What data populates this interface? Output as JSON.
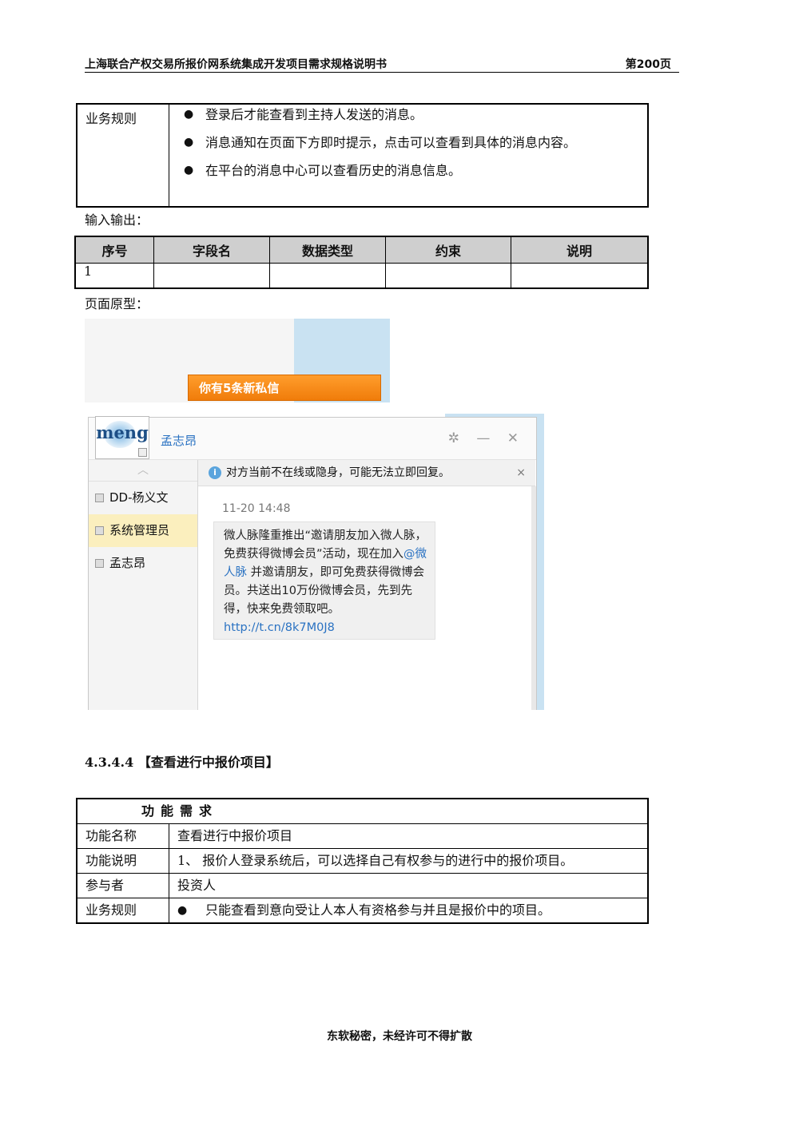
{
  "header": {
    "title": "上海联合产权交易所报价网系统集成开发项目需求规格说明书",
    "page": "第200页"
  },
  "rules_table": {
    "key": "业务规则",
    "items": [
      "登录后才能查看到主持人发送的消息。",
      "消息通知在页面下方即时提示，点击可以查看到具体的消息内容。",
      "在平台的消息中心可以查看历史的消息信息。"
    ]
  },
  "io_label": "输入输出：",
  "io_table": {
    "headers": [
      "序号",
      "字段名",
      "数据类型",
      "约束",
      "说明"
    ],
    "rows": [
      [
        "1",
        "",
        "",
        "",
        ""
      ]
    ]
  },
  "proto_label": "页面原型：",
  "prototype": {
    "toast": "你有5条新私信",
    "logo_text": "meng",
    "chat_user": "孟志昂",
    "controls": "✲ — ✕",
    "contacts": [
      {
        "name": "DD-杨义文",
        "selected": false
      },
      {
        "name": "系统管理员",
        "selected": true
      },
      {
        "name": "孟志昂",
        "selected": false
      }
    ],
    "notice": "对方当前不在线或隐身，可能无法立即回复。",
    "notice_close": "×",
    "timestamp": "11-20 14:48",
    "message_part1": "微人脉隆重推出“邀请朋友加入微人脉，免费获得微博会员”活动，现在加入",
    "message_mention": "@微人脉",
    "message_part2": " 并邀请朋友，即可免费获得微博会员。共送出10万份微博会员，先到先得，快来免费领取吧。",
    "message_link": "http://t.cn/8k7M0J8"
  },
  "section_title": "4.3.4.4 【查看进行中报价项目】",
  "func_table": {
    "heading": "功能需求",
    "rows": [
      {
        "k": "功能名称",
        "v": "查看进行中报价项目"
      },
      {
        "k": "功能说明",
        "v": "1、 报价人登录系统后，可以选择自己有权参与的进行中的报价项目。"
      },
      {
        "k": "参与者",
        "v": "投资人"
      },
      {
        "k": "业务规则",
        "v": "只能查看到意向受让人本人有资格参与并且是报价中的项目。"
      }
    ]
  },
  "footer": "东软秘密，未经许可不得扩散"
}
